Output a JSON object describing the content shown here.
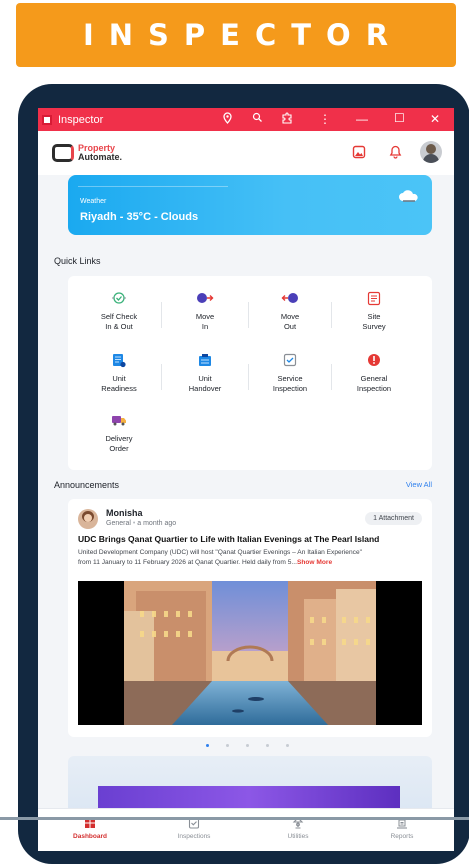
{
  "banner": {
    "title": "INSPECTOR"
  },
  "window": {
    "title": "Inspector",
    "controls": [
      "location-icon",
      "zoom-icon",
      "extension-icon",
      "more-icon",
      "minimize",
      "maximize",
      "close"
    ]
  },
  "header": {
    "brand_line1": "Property",
    "brand_line2": "Automate."
  },
  "weather": {
    "label": "Weather",
    "value": "Riyadh - 35°C - Clouds"
  },
  "quick_links": {
    "title": "Quick Links",
    "items": [
      {
        "label1": "Self Check",
        "label2": "In & Out",
        "icon": "self-check-icon"
      },
      {
        "label1": "Move",
        "label2": "In",
        "icon": "move-in-icon"
      },
      {
        "label1": "Move",
        "label2": "Out",
        "icon": "move-out-icon"
      },
      {
        "label1": "Site",
        "label2": "Survey",
        "icon": "site-survey-icon"
      },
      {
        "label1": "Unit",
        "label2": "Readiness",
        "icon": "unit-readiness-icon"
      },
      {
        "label1": "Unit",
        "label2": "Handover",
        "icon": "unit-handover-icon"
      },
      {
        "label1": "Service",
        "label2": "Inspection",
        "icon": "service-inspection-icon"
      },
      {
        "label1": "General",
        "label2": "Inspection",
        "icon": "general-inspection-icon"
      },
      {
        "label1": "Delivery",
        "label2": "Order",
        "icon": "delivery-order-icon"
      }
    ]
  },
  "announcements": {
    "title": "Announcements",
    "view_all": "View All",
    "post": {
      "author": "Monisha",
      "category": "General",
      "time": "a month ago",
      "attachments": "1 Attachment",
      "headline": "UDC Brings Qanat Quartier to Life with Italian Evenings at The Pearl Island",
      "body_line1": "United Development Company (UDC) will host \"Qanat Quartier Evenings – An Italian Experience\"",
      "body_line2": "from 11 January to 11 February 2026 at Qanat Quartier. Held daily from 5...",
      "show_more": "Show More"
    }
  },
  "bottom_nav": [
    {
      "label": "Dashboard",
      "icon": "dashboard-icon",
      "active": true
    },
    {
      "label": "Inspections",
      "icon": "checklist-icon",
      "active": false
    },
    {
      "label": "Utilities",
      "icon": "lamp-icon",
      "active": false
    },
    {
      "label": "Reports",
      "icon": "reports-icon",
      "active": false
    }
  ],
  "colors": {
    "banner": "#f59a1b",
    "device": "#122840",
    "titlebar": "#f0304a",
    "accent": "#2f80ed",
    "brand_red": "#e8454b"
  }
}
